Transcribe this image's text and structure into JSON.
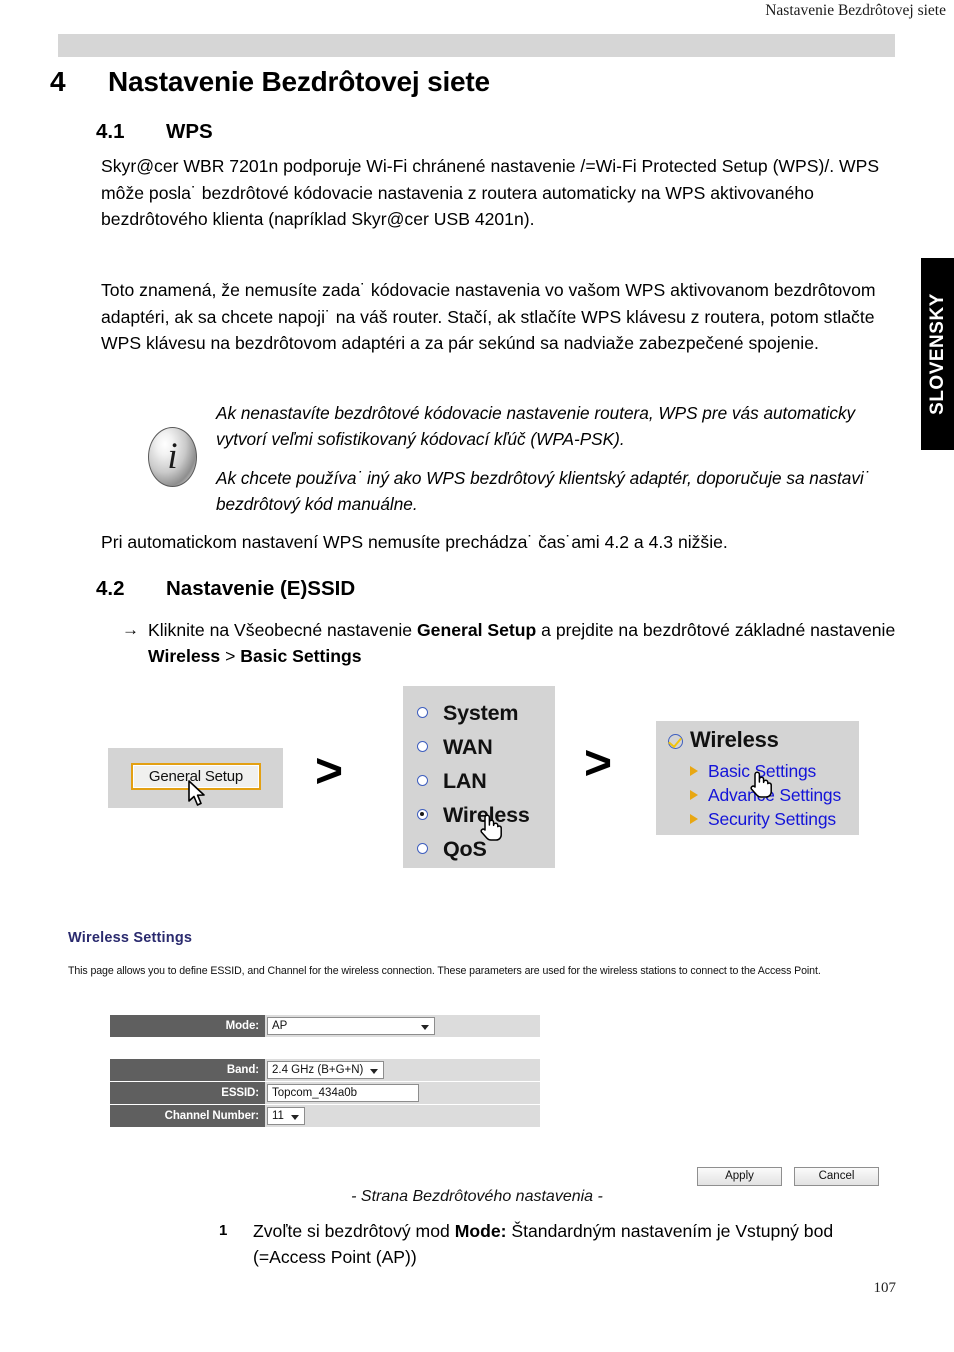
{
  "header": {
    "running_title": "Nastavenie Bezdrôtovej siete"
  },
  "side_tab": {
    "label": "SLOVENSKY"
  },
  "chapter": {
    "number": "4",
    "title": "Nastavenie Bezdrôtovej siete"
  },
  "sections": {
    "wps": {
      "number": "4.1",
      "title": "WPS",
      "para1": " Skyr@cer WBR 7201n podporuje  Wi-Fi chránené nastavenie /=Wi-Fi Protected Setup (WPS)/. WPS môže posla˙ bezdrôtové kódovacie nastavenia z routera automaticky na WPS aktivovaného bezdrôtového klienta (napríklad Skyr@cer USB 4201n).",
      "para2": "Toto znamená, že nemusíte zada˙ kódovacie nastavenia vo vašom WPS aktivovanom bezdrôtovom adaptéri, ak sa chcete napoji˙ na váš router.  Stačí, ak stlačíte WPS klávesu z routera, potom stlačte WPS klávesu na bezdrôtovom adaptéri a za pár sekúnd sa nadviaže zabezpečené spojenie.",
      "note_line1": "Ak nenastavíte bezdrôtové kódovacie nastavenie routera, WPS pre vás automaticky vytvorí veľmi sofistikovaný kódovací kľúč (WPA-PSK).",
      "note_line2": "Ak chcete používa˙ iný ako WPS bezdrôtový klientský adaptér, doporučuje sa nastavi˙ bezdrôtový kód manuálne.",
      "para3": "Pri automatickom nastavení WPS nemusíte prechádza˙ čas˙ami 4.2 a 4.3 nižšie."
    },
    "essid": {
      "number": "4.2",
      "title": "Nastavenie (E)SSID",
      "instruction_prefix": "Kliknite na Všeobecné nastavenie ",
      "instruction_bold1": "General Setup",
      "instruction_mid": " a prejdite na bezdrôtové základné nastavenie  ",
      "instruction_bold2": "Wireless",
      "instruction_sep": " > ",
      "instruction_bold3": "Basic Settings",
      "arrow_glyph": "→"
    }
  },
  "flow": {
    "chevron": ">",
    "general_setup_button": "General Setup",
    "menu_items": [
      {
        "label": "System",
        "selected": false
      },
      {
        "label": "WAN",
        "selected": false
      },
      {
        "label": "LAN",
        "selected": false
      },
      {
        "label": "Wireless",
        "selected": true
      },
      {
        "label": "QoS",
        "selected": false
      }
    ],
    "wireless_panel": {
      "title": "Wireless",
      "links": [
        "Basic Settings",
        "Advance Settings",
        "Security Settings"
      ]
    }
  },
  "wireless_settings": {
    "title": "Wireless Settings",
    "description": "This page allows you to define ESSID, and Channel for the wireless connection. These parameters are used for the wireless stations to connect to the Access Point.",
    "fields": [
      {
        "label": "Mode:",
        "value": "AP",
        "control": "select"
      },
      {
        "label": "Band:",
        "value": "2.4 GHz (B+G+N)",
        "control": "select"
      },
      {
        "label": "ESSID:",
        "value": "Topcom_434a0b",
        "control": "text"
      },
      {
        "label": "Channel Number:",
        "value": "11",
        "control": "select"
      }
    ],
    "apply_label": "Apply",
    "cancel_label": "Cancel",
    "caption": "- Strana Bezdrôtového nastavenia -"
  },
  "step1": {
    "number": "1",
    "text_prefix": "Zvoľte si bezdrôtový mod  ",
    "text_bold": "Mode:",
    "text_suffix": " Štandardným nastavením je Vstupný bod (=Access Point (AP))"
  },
  "footer": {
    "page_number": "107"
  },
  "colors": {
    "header_bar": "#d6d6d6",
    "tab_bg": "#000000",
    "link_blue": "#1414d8",
    "label_gray": "#5f5f5f",
    "panel_gray": "#d4d4d4",
    "title_navy": "#2a2a6e",
    "bullet_orange": "#e8a712"
  }
}
